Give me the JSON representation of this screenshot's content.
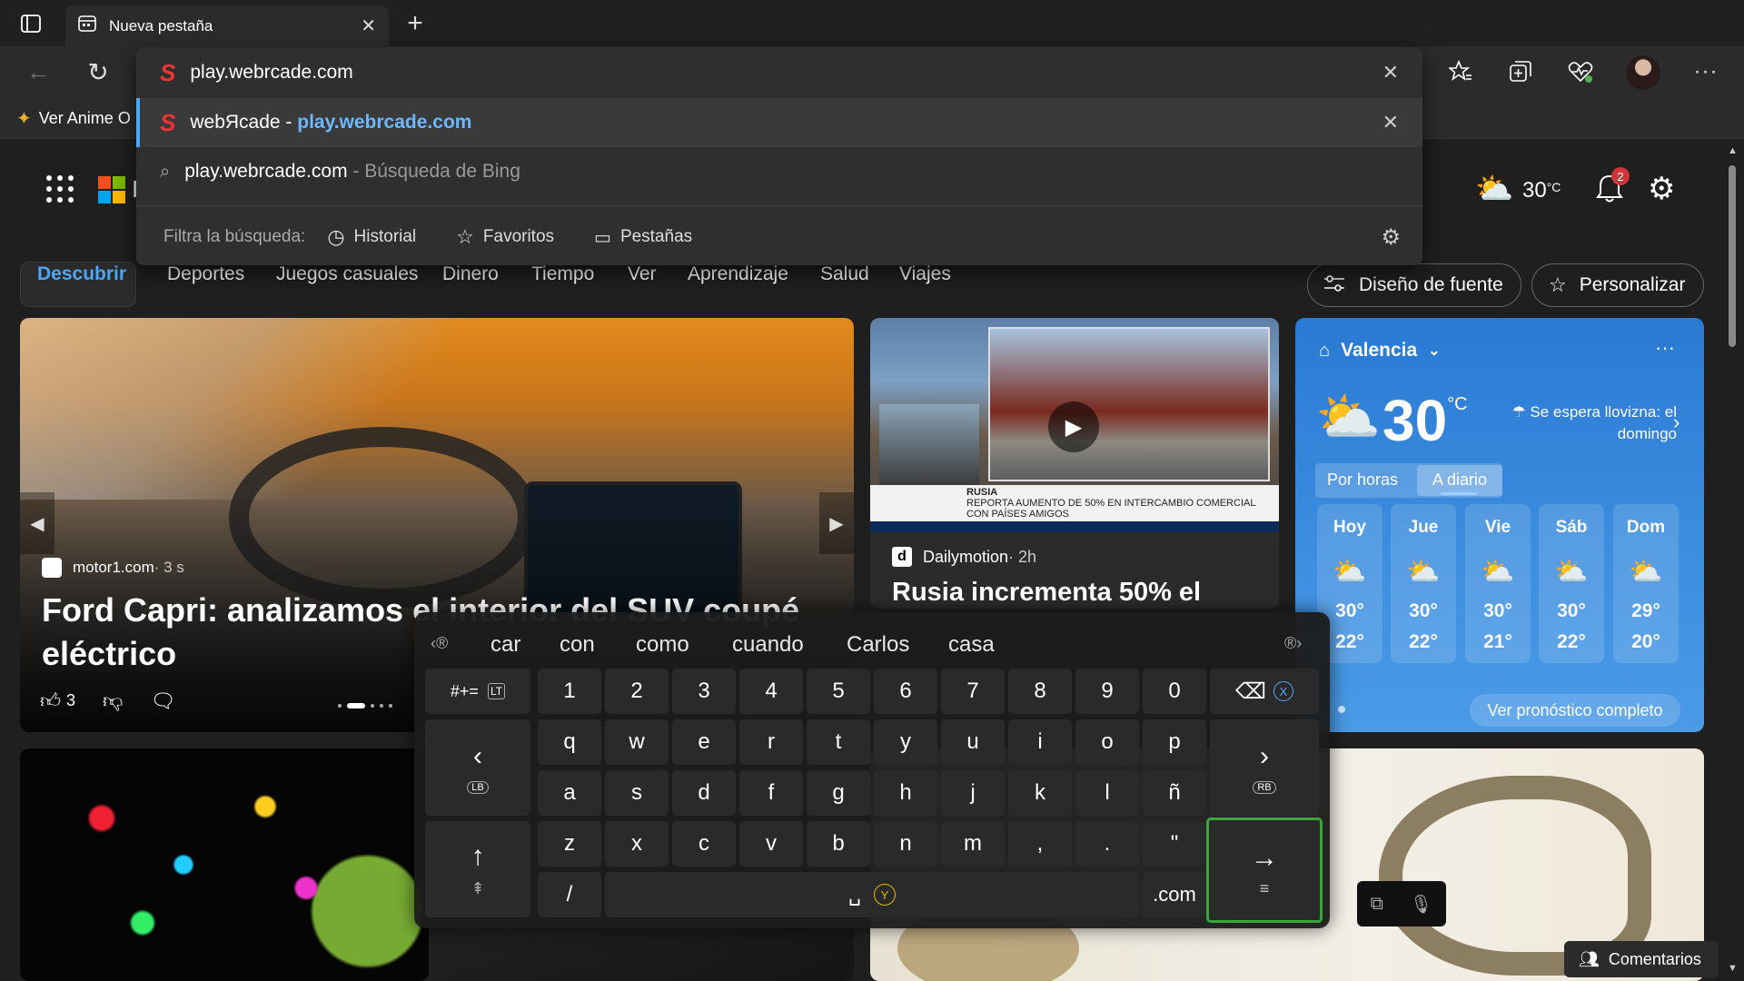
{
  "tab": {
    "title": "Nueva pestaña"
  },
  "address": {
    "value": "play.webrcade.com"
  },
  "favorites_bar": {
    "item": "Ver Anime O"
  },
  "omnibox": {
    "suggestion_site_name": "webЯcade",
    "suggestion_sep": " - ",
    "suggestion_url": "play.webrcade.com",
    "search_query": "play.webrcade.com",
    "search_suffix": " - Búsqueda de Bing",
    "filter_label": "Filtra la búsqueda:",
    "filter_history": "Historial",
    "filter_favorites": "Favoritos",
    "filter_tabs": "Pestañas"
  },
  "header": {
    "temp": "30",
    "temp_unit": "°C",
    "notif_count": "2",
    "brand_partial": "I"
  },
  "nav": {
    "tabs": [
      "Descubrir",
      "Deportes",
      "Juegos casuales",
      "Dinero",
      "Tiempo",
      "Ver",
      "Aprendizaje",
      "Salud",
      "Viajes"
    ],
    "font_design": "Diseño de fuente",
    "personalize": "Personalizar"
  },
  "hero": {
    "source": "motor1.com",
    "age": " · 3 s",
    "title": "Ford Capri: analizamos el interior del SUV coupé eléctrico",
    "likes": "3"
  },
  "video": {
    "source": "Dailymotion",
    "age": " · 2h",
    "title": "Rusia incrementa 50% el",
    "caption_tag": "RUSIA",
    "caption_text": "REPORTA AUMENTO DE 50% EN INTERCAMBIO COMERCIAL CON PAÍSES AMIGOS"
  },
  "weather": {
    "city": "Valencia",
    "temp": "30",
    "unit": "°C",
    "forecast_note": "Se espera llovizna: el domingo",
    "tab_hourly": "Por horas",
    "tab_daily": "A diario",
    "days": [
      {
        "day": "Hoy",
        "high": "30°",
        "low": "22°"
      },
      {
        "day": "Jue",
        "high": "30°",
        "low": "22°"
      },
      {
        "day": "Vie",
        "high": "30°",
        "low": "21°"
      },
      {
        "day": "Sáb",
        "high": "30°",
        "low": "22°"
      },
      {
        "day": "Dom",
        "high": "29°",
        "low": "20°"
      }
    ],
    "full_forecast": "Ver pronóstico completo"
  },
  "keyboard": {
    "suggestions": [
      "car",
      "con",
      "como",
      "cuando",
      "Carlos",
      "casa"
    ],
    "symbols_key": "#+=",
    "row_numbers": [
      "1",
      "2",
      "3",
      "4",
      "5",
      "6",
      "7",
      "8",
      "9",
      "0"
    ],
    "row1": [
      "q",
      "w",
      "e",
      "r",
      "t",
      "y",
      "u",
      "i",
      "o",
      "p"
    ],
    "row2": [
      "a",
      "s",
      "d",
      "f",
      "g",
      "h",
      "j",
      "k",
      "l",
      "ñ"
    ],
    "row3": [
      "z",
      "x",
      "c",
      "v",
      "b",
      "n",
      "m",
      ",",
      ".",
      "\""
    ],
    "slash": "/",
    "dotcom": ".com",
    "lb": "LB",
    "rb": "RB",
    "y_hint": "Y",
    "x_hint": "X",
    "lt_hint": "LT"
  },
  "feedback": "Comentarios"
}
